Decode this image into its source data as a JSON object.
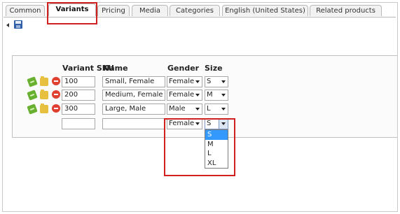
{
  "tabs": [
    {
      "label": "Common"
    },
    {
      "label": "Variants"
    },
    {
      "label": "Pricing"
    },
    {
      "label": "Media"
    },
    {
      "label": "Categories"
    },
    {
      "label": "English (United States)"
    },
    {
      "label": "Related products"
    }
  ],
  "table": {
    "headers": {
      "sku": "Variant SKU",
      "name": "Name",
      "gender": "Gender",
      "size": "Size"
    },
    "rows": [
      {
        "sku": "100",
        "name": "Small, Female",
        "gender": "Female",
        "size": "S"
      },
      {
        "sku": "200",
        "name": "Medium, Female",
        "gender": "Female",
        "size": "M"
      },
      {
        "sku": "300",
        "name": "Large, Male",
        "gender": "Male",
        "size": "L"
      }
    ],
    "new_row": {
      "sku": "",
      "name": "",
      "gender": "Female",
      "size": "S"
    }
  },
  "size_dropdown": {
    "options": [
      "S",
      "M",
      "L",
      "XL"
    ],
    "selected": "S"
  },
  "colors": {
    "highlight": "#d02020",
    "selection": "#3399ff"
  }
}
